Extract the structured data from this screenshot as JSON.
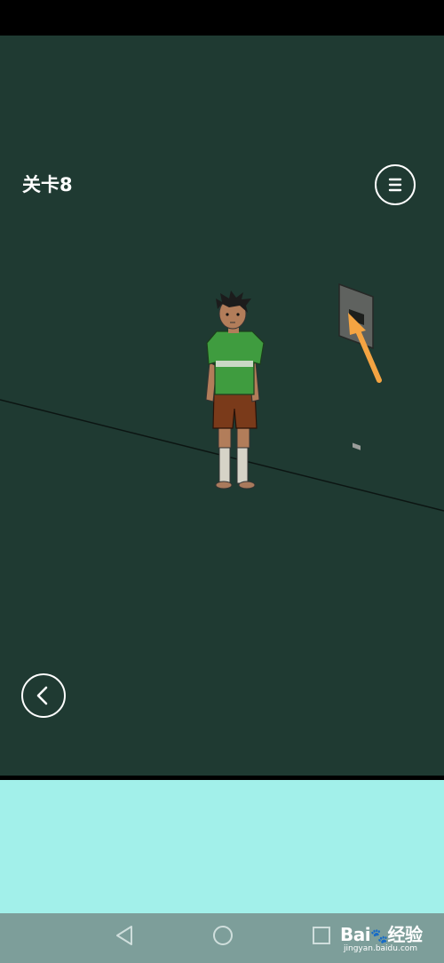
{
  "header": {
    "level_label": "关卡8"
  },
  "icons": {
    "menu": "menu-icon",
    "back": "chevron-left-icon",
    "nav_back": "triangle-back-icon",
    "nav_home": "circle-home-icon",
    "nav_recent": "square-recent-icon"
  },
  "watermark": {
    "brand_a": "Bai",
    "brand_b": "经验",
    "url": "jingyan.baidu.com"
  },
  "colors": {
    "scene_background": "#1f3a32",
    "bottom_panel": "#a2f0ea",
    "nav_bar": "#7d9e9a",
    "arrow": "#f4a442",
    "shirt": "#3f9c3f",
    "shorts": "#7a3a1a"
  }
}
